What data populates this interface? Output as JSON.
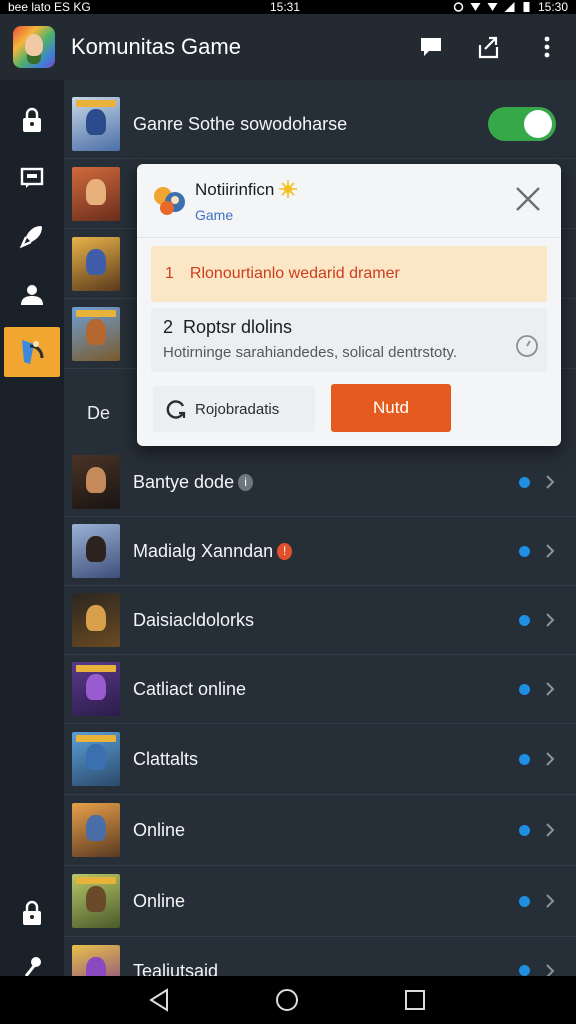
{
  "status_bar": {
    "left_text": "bee lato  ES  KG",
    "time": "15:31",
    "right_text": "15:30"
  },
  "app_bar": {
    "title": "Komunitas Game",
    "actions": [
      "chat-icon",
      "share-icon",
      "more-vert-icon"
    ]
  },
  "sidebar": {
    "items": [
      {
        "icon": "lock-icon",
        "active": false
      },
      {
        "icon": "message-icon",
        "active": false
      },
      {
        "icon": "rocket-icon",
        "active": false
      },
      {
        "icon": "people-icon",
        "active": false
      },
      {
        "icon": "game-char-icon",
        "active": true
      }
    ],
    "bottom_items": [
      {
        "icon": "lock-icon"
      },
      {
        "icon": "pin-icon"
      }
    ]
  },
  "top_row": {
    "label": "Ganre Sothe sowodoharse",
    "toggle_on": true
  },
  "section_label": "De",
  "list": [
    {
      "label": "Bantye dode",
      "badge": "i",
      "badge_color": "#6e7680"
    },
    {
      "label": "Madialg Xanndan",
      "badge": "!",
      "badge_color": "#e0502a"
    },
    {
      "label": "Daisiacldolorks",
      "badge": "",
      "badge_color": ""
    },
    {
      "label": "Catliact online",
      "badge": "",
      "badge_color": ""
    },
    {
      "label": "Clattalts",
      "badge": "",
      "badge_color": ""
    },
    {
      "label": "Online",
      "badge": "",
      "badge_color": ""
    },
    {
      "label": "Online",
      "badge": "",
      "badge_color": ""
    },
    {
      "label": "Tealiutsaid",
      "badge": "",
      "badge_color": ""
    }
  ],
  "popup": {
    "title": "Notiirinficn",
    "subtitle": "Game",
    "alert_num": "1",
    "alert_text": "Rlonourtianlo wedarid dramer",
    "info_num": "2",
    "info_title": "Roptsr dlolins",
    "info_desc": "Hotirninge sarahiandedes, solical dentrstoty.",
    "secondary_button": "Rojobradatis",
    "primary_button": "Nutd"
  },
  "colors": {
    "accent_orange": "#e55a1e",
    "sidebar_active": "#f0a630",
    "toggle_green": "#37a84a",
    "dot_blue": "#1e8fe3"
  }
}
